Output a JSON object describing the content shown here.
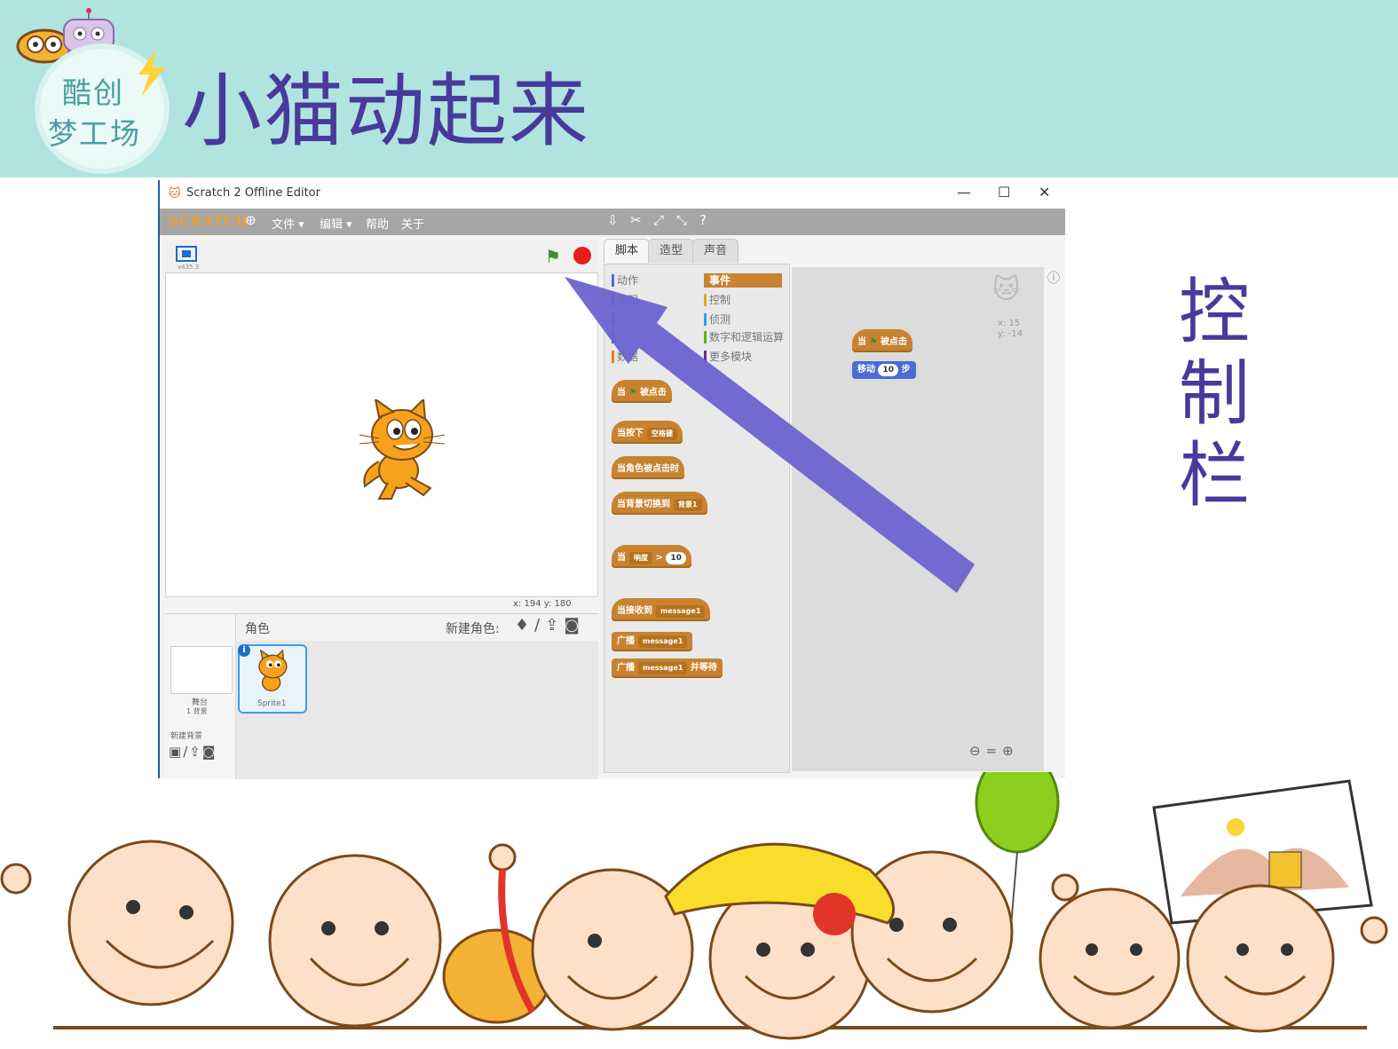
{
  "slide": {
    "title": "小猫动起来",
    "logo_line1": "酷创",
    "logo_line2": "梦工场",
    "side_label": [
      "控",
      "制",
      "栏"
    ]
  },
  "window": {
    "title": "Scratch 2 Offline Editor",
    "minimize": "—",
    "maximize": "☐",
    "close": "✕"
  },
  "menubar": {
    "logo": "SCRATCH",
    "items": [
      "文件 ▾",
      "编辑 ▾",
      "帮助",
      "关于"
    ]
  },
  "stage": {
    "version": "v435.3",
    "coords": "x: 194   y: 180"
  },
  "sprites": {
    "header": "角色",
    "new_sprite": "新建角色:",
    "stage_label": "舞台",
    "stage_bg_count": "1 背景",
    "new_backdrop": "新建背景",
    "sprite_name": "Sprite1"
  },
  "tabs": [
    "脚本",
    "造型",
    "声音"
  ],
  "categories": {
    "left": [
      "动作",
      "外观",
      "",
      "",
      "数据"
    ],
    "right": [
      "事件",
      "控制",
      "侦测",
      "数字和逻辑运算",
      "更多模块"
    ],
    "left_colors": [
      "#4a6cd4",
      "#8a55d7",
      "#bb42c3",
      "#2ca5e2",
      "#ee7d16"
    ],
    "right_colors": [
      "#c88330",
      "#e1a91a",
      "#2ca5e2",
      "#5cb712",
      "#632d99"
    ]
  },
  "blocks": {
    "flag_hat": [
      "当",
      "被点击"
    ],
    "key_hat": [
      "当按下",
      "空格键"
    ],
    "sprite_click": "当角色被点击时",
    "backdrop_switch": [
      "当背景切换到",
      "背景1"
    ],
    "loudness": [
      "当",
      "响度",
      ">",
      "10"
    ],
    "receive": [
      "当接收到",
      "message1"
    ],
    "broadcast": [
      "广播",
      "message1"
    ],
    "broadcast_wait": [
      "广播",
      "message1",
      "并等待"
    ]
  },
  "script_area": {
    "hat": [
      "当",
      "被点击"
    ],
    "move": [
      "移动",
      "10",
      "步"
    ],
    "sprite_x": "x: 15",
    "sprite_y": "y: -14"
  },
  "colors": {
    "banner": "#b1e4df",
    "title": "#483a9c",
    "events": "#c88330",
    "motion": "#4a6cd4",
    "arrow": "#6b62d0"
  }
}
